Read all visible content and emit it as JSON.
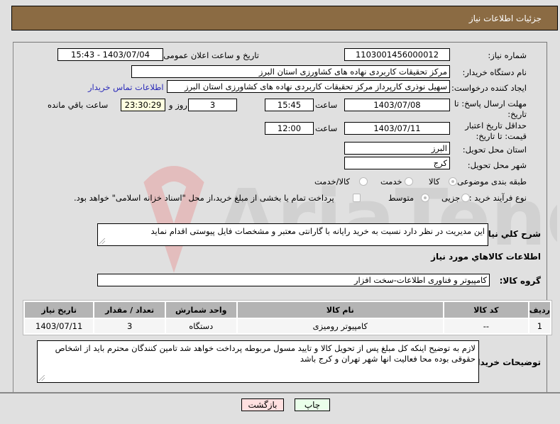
{
  "header": {
    "title": "جزئيات اطلاعات نیاز"
  },
  "fields": {
    "need_number": {
      "label": "شماره نیاز:",
      "value": "1103001456000012"
    },
    "announce_datetime": {
      "label": "تاریخ و ساعت اعلان عمومی:",
      "value": "1403/07/04 - 15:43"
    },
    "buyer_org": {
      "label": "نام دستگاه خریدار:",
      "value": "مرکز تحقیقات کاربردی نهاده های کشاورزی استان البرز"
    },
    "requester": {
      "label": "ایجاد کننده درخواست:",
      "value": "سهیل  نوذری  کارپرداز مرکز تحقیقات کاربردی نهاده های کشاورزی استان البرز",
      "contact_link": "اطلاعات تماس خریدار"
    },
    "reply_deadline": {
      "label": "مهلت ارسال پاسخ: تا تاریخ:",
      "date": "1403/07/08",
      "time_label": "ساعت",
      "time": "15:45",
      "days": "3",
      "days_label": "روز و",
      "remaining": "23:30:29",
      "remaining_label": "ساعت باقي مانده"
    },
    "price_validity": {
      "label": "حداقل تاریخ اعتبار قیمت: تا تاریخ:",
      "date": "1403/07/11",
      "time_label": "ساعت",
      "time": "12:00"
    },
    "province": {
      "label": "استان محل تحویل:",
      "value": "البرز"
    },
    "city": {
      "label": "شهر محل تحویل:",
      "value": "کرج"
    },
    "category": {
      "label": "طبقه بندی موضوعی:",
      "options": [
        "کالا",
        "خدمت",
        "کالا/خدمت"
      ],
      "selected": "کالا"
    },
    "purchase_type": {
      "label": "نوع فرآیند خرید :",
      "options": [
        "جزیی",
        "متوسط"
      ],
      "selected": "متوسط",
      "treasury_note": "پرداخت تمام یا بخشی از مبلغ خرید،از محل \"اسناد خزانه اسلامی\" خواهد بود."
    }
  },
  "description": {
    "label": "شرح کلي نیاز:",
    "value": "این مدیریت در نظر دارد نسبت به خرید رایانه با گارانتی معتبر و مشخصات فایل پیوستی اقدام نماید"
  },
  "goods_section_title": "اطلاعات کالاهاي مورد نیاز",
  "goods_group": {
    "label": "گروه کالا:",
    "value": "کامپیوتر و فناوری اطلاعات-سخت افزار"
  },
  "table": {
    "headers": [
      "ردیف",
      "کد کالا",
      "نام کالا",
      "واحد شمارش",
      "تعداد / مقدار",
      "تاریخ نیاز"
    ],
    "rows": [
      [
        "1",
        "--",
        "کامپیوتر رومیزی",
        "دستگاه",
        "3",
        "1403/07/11"
      ]
    ]
  },
  "buyer_notes": {
    "label": "توضیحات خریدار:",
    "value": "لازم به توضیح اینکه کل مبلغ پس از تحویل کالا و تایید مسول مربوطه پرداخت خواهد شد تامین کنندگان محترم باید از اشخاص حقوقی بوده محا فعالیت انها شهر تهران و کرج باشد"
  },
  "buttons": {
    "print": "چاپ",
    "back": "بازگشت"
  },
  "colors": {
    "header_bg": "#8b6b43",
    "print_bg": "#eaffea",
    "back_bg": "#ffe0e0",
    "link": "#2a2ab8"
  }
}
